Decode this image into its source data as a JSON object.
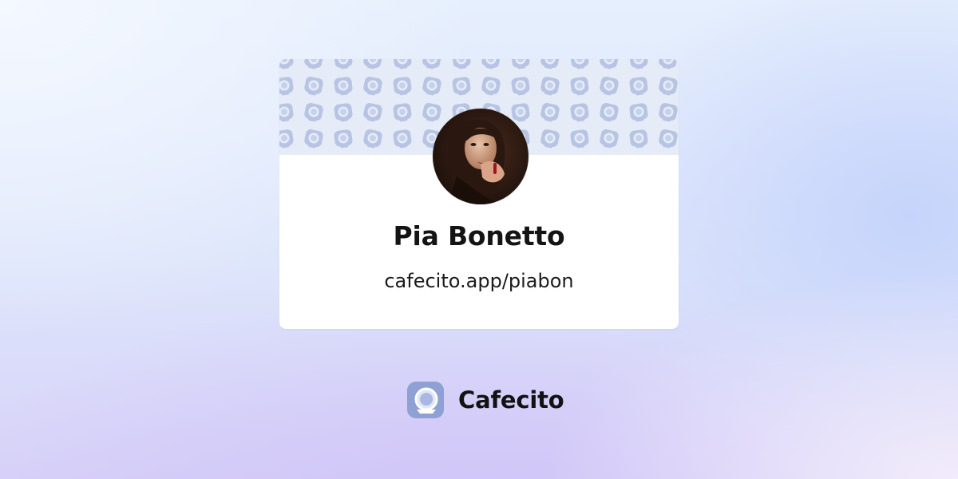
{
  "profile": {
    "name": "Pia Bonetto",
    "url": "cafecito.app/piabon"
  },
  "brand": {
    "name": "Cafecito",
    "logo_icon": "cafecito-cup-icon"
  },
  "banner": {
    "pattern_icon": "coffee-cup-icon",
    "background_color": "#e6ecf7",
    "icon_color": "#b5c2e2"
  },
  "avatar": {
    "description_icon": "profile-photo"
  },
  "colors": {
    "card": "#ffffff",
    "text": "#141414",
    "logo_fill": "#8fa0d3"
  }
}
